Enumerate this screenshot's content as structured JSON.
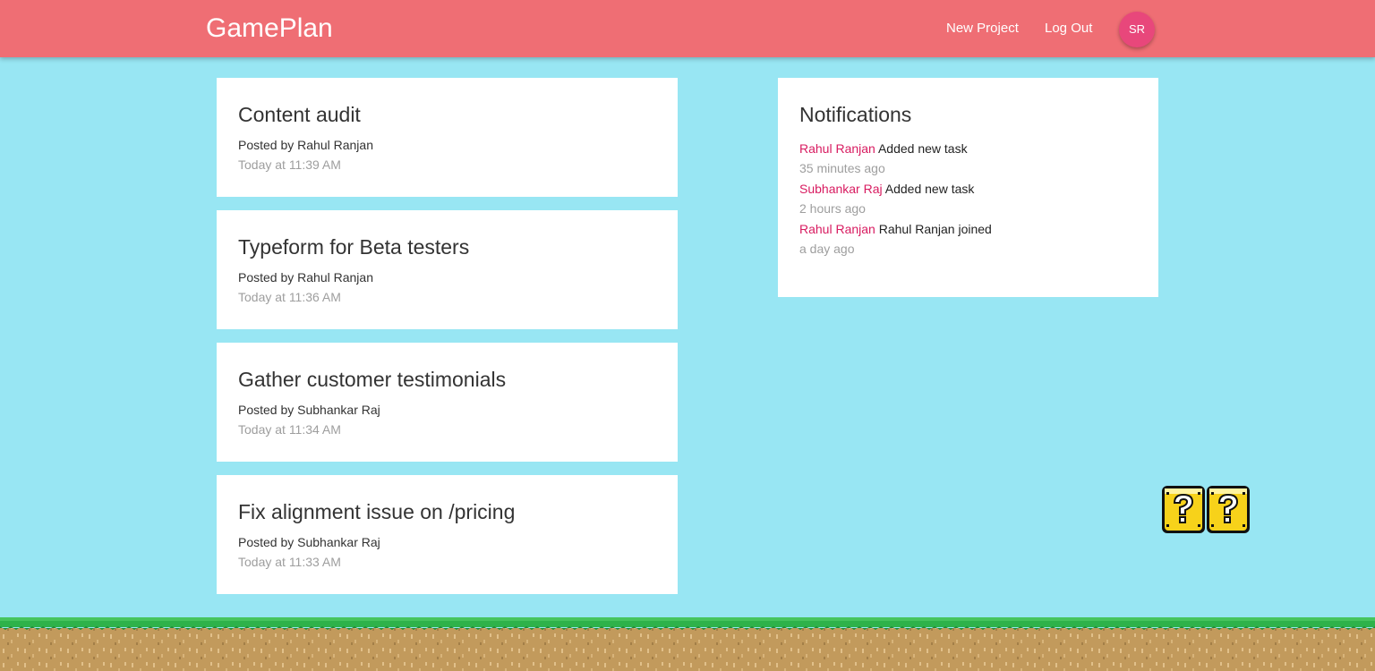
{
  "navbar": {
    "brand": "GamePlan",
    "new_project": "New Project",
    "log_out": "Log Out",
    "avatar_initials": "SR"
  },
  "projects": [
    {
      "title": "Content audit",
      "posted_by": "Posted by Rahul Ranjan",
      "time": "Today at 11:39 AM"
    },
    {
      "title": "Typeform for Beta testers",
      "posted_by": "Posted by Rahul Ranjan",
      "time": "Today at 11:36 AM"
    },
    {
      "title": "Gather customer testimonials",
      "posted_by": "Posted by Subhankar Raj",
      "time": "Today at 11:34 AM"
    },
    {
      "title": "Fix alignment issue on /pricing",
      "posted_by": "Posted by Subhankar Raj",
      "time": "Today at 11:33 AM"
    }
  ],
  "notifications": {
    "title": "Notifications",
    "items": [
      {
        "user": "Rahul Ranjan",
        "action": "Added new task",
        "time": "35 minutes ago"
      },
      {
        "user": "Subhankar Raj",
        "action": "Added new task",
        "time": "2 hours ago"
      },
      {
        "user": "Rahul Ranjan",
        "action": "Rahul Ranjan joined",
        "time": "a day ago"
      }
    ]
  },
  "colors": {
    "navbar": "#ef6e74",
    "background": "#98e6f3",
    "avatar": "#e8477b",
    "notification_user": "#d81b60",
    "grass": "#2eb24a",
    "dirt": "#c29a5c"
  },
  "decorations": {
    "question_blocks": "question-block-icon",
    "ground": "grass-dirt-ground"
  }
}
